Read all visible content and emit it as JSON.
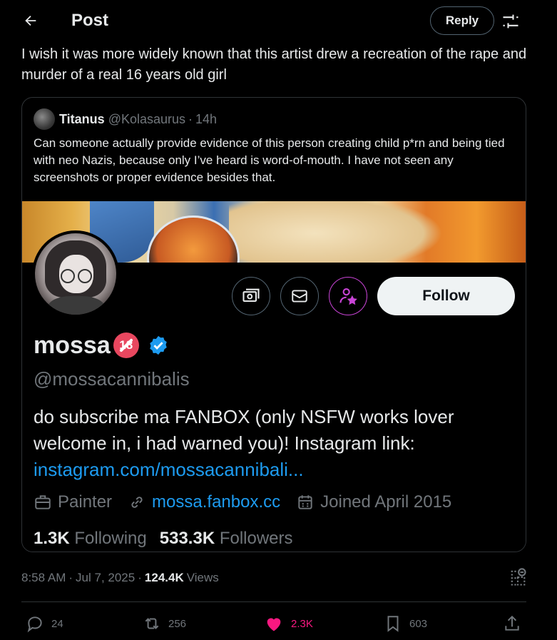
{
  "header": {
    "title": "Post",
    "reply_label": "Reply"
  },
  "tweet": {
    "text": "I wish it was more widely known that this artist drew a recreation of the rape and murder of a real 16 years old girl"
  },
  "quote": {
    "name": "Titanus",
    "handle": "@Kolasaurus",
    "dot": "·",
    "time": "14h",
    "text": "Can someone actually provide evidence of this person creating child p*rn and being tied with neo Nazis, because only I’ve heard is word-of-mouth. I have not seen any screenshots or proper evidence besides that."
  },
  "profile": {
    "follow_label": "Follow",
    "name": "mossa",
    "nsfw_badge": "18",
    "handle": "@mossacannibalis",
    "bio": "do subscribe ma FANBOX (only NSFW works lover welcome in, i had warned you)! Instagram link:",
    "bio_link": "instagram.com/mossacannibali...",
    "profession": "Painter",
    "website": "mossa.fanbox.cc",
    "joined": "Joined April 2015",
    "following_count": "1.3K",
    "following_label": "Following",
    "followers_count": "533.3K",
    "followers_label": "Followers"
  },
  "meta": {
    "time": "8:58 AM",
    "sep1": "·",
    "date": "Jul 7, 2025",
    "sep2": "·",
    "views_count": "124.4K",
    "views_label": "Views"
  },
  "actions": {
    "replies": "24",
    "reposts": "256",
    "likes": "2.3K",
    "bookmarks": "603"
  },
  "colors": {
    "accent": "#1d9bf0",
    "like": "#f91880",
    "muted": "#71767b",
    "subscribe": "#c944d6"
  }
}
